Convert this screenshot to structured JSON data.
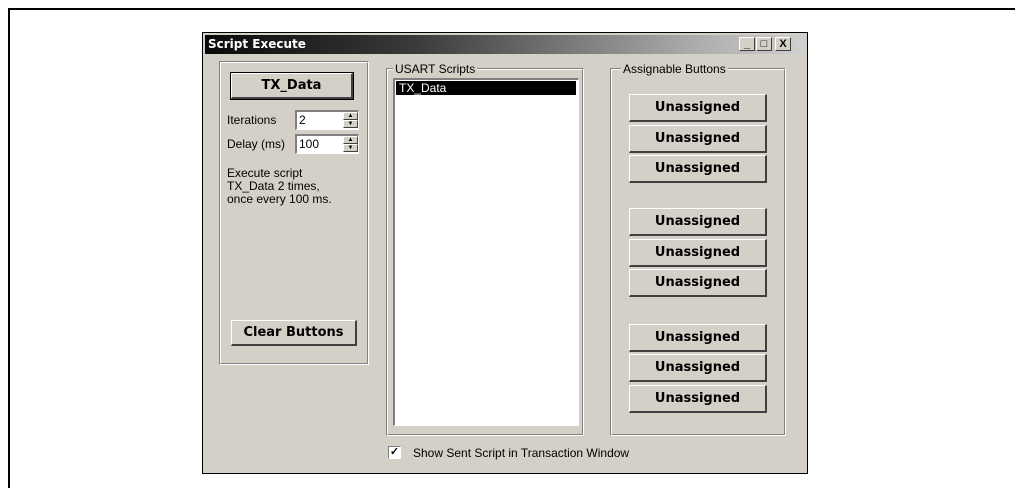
{
  "window": {
    "title": "Script Execute",
    "controls": {
      "minimize": "_",
      "maximize": "□",
      "close": "X"
    }
  },
  "left_panel": {
    "script_button": "TX_Data",
    "iterations_label": "Iterations",
    "iterations_value": "2",
    "delay_label": "Delay (ms)",
    "delay_value": "100",
    "description_line1": "Execute script",
    "description_line2": "TX_Data 2 times,",
    "description_line3": "once every 100 ms.",
    "clear_button": "Clear Buttons"
  },
  "scripts_panel": {
    "legend": "USART Scripts",
    "items": [
      "TX_Data"
    ]
  },
  "assignable_panel": {
    "legend": "Assignable Buttons",
    "buttons": [
      "Unassigned",
      "Unassigned",
      "Unassigned",
      "Unassigned",
      "Unassigned",
      "Unassigned",
      "Unassigned",
      "Unassigned",
      "Unassigned"
    ]
  },
  "footer": {
    "show_sent_checkbox_checked": true,
    "show_sent_label": "Show Sent Script in Transaction Window"
  }
}
